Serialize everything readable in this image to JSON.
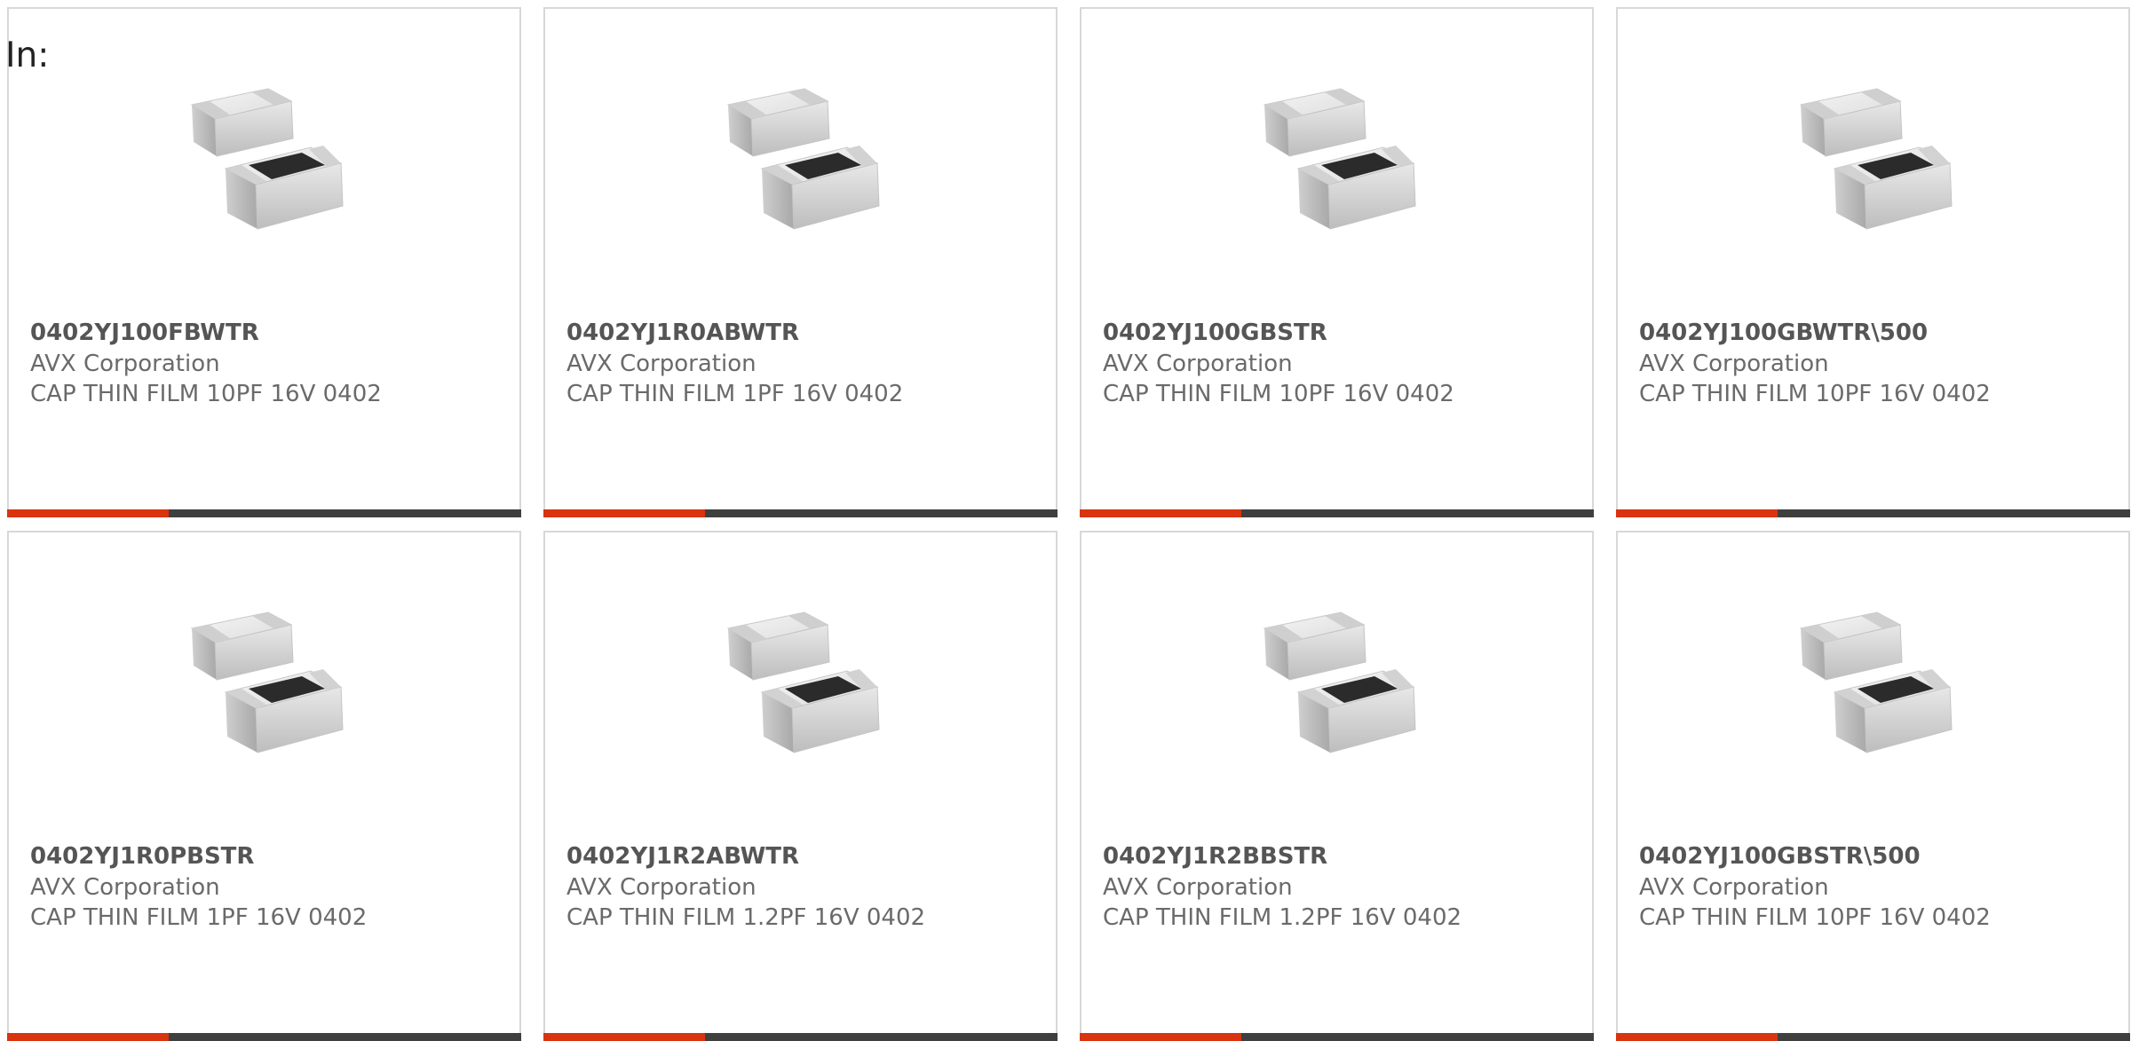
{
  "filter": {
    "label": "In:"
  },
  "colors": {
    "accent": "#d9340f",
    "bar": "#3f3f3f",
    "border": "#d8d8d8"
  },
  "products": [
    {
      "part_number": "0402YJ100FBWTR",
      "manufacturer": "AVX Corporation",
      "description": "CAP THIN FILM 10PF 16V 0402",
      "image_icon": "smd-capacitor-image"
    },
    {
      "part_number": "0402YJ1R0ABWTR",
      "manufacturer": "AVX Corporation",
      "description": "CAP THIN FILM 1PF 16V 0402",
      "image_icon": "smd-capacitor-image"
    },
    {
      "part_number": "0402YJ100GBSTR",
      "manufacturer": "AVX Corporation",
      "description": "CAP THIN FILM 10PF 16V 0402",
      "image_icon": "smd-capacitor-image"
    },
    {
      "part_number": "0402YJ100GBWTR\\500",
      "manufacturer": "AVX Corporation",
      "description": "CAP THIN FILM 10PF 16V 0402",
      "image_icon": "smd-capacitor-image"
    },
    {
      "part_number": "0402YJ1R0PBSTR",
      "manufacturer": "AVX Corporation",
      "description": "CAP THIN FILM 1PF 16V 0402",
      "image_icon": "smd-capacitor-image"
    },
    {
      "part_number": "0402YJ1R2ABWTR",
      "manufacturer": "AVX Corporation",
      "description": "CAP THIN FILM 1.2PF 16V 0402",
      "image_icon": "smd-capacitor-image"
    },
    {
      "part_number": "0402YJ1R2BBSTR",
      "manufacturer": "AVX Corporation",
      "description": "CAP THIN FILM 1.2PF 16V 0402",
      "image_icon": "smd-capacitor-image"
    },
    {
      "part_number": "0402YJ100GBSTR\\500",
      "manufacturer": "AVX Corporation",
      "description": "CAP THIN FILM 10PF 16V 0402",
      "image_icon": "smd-capacitor-image"
    }
  ]
}
